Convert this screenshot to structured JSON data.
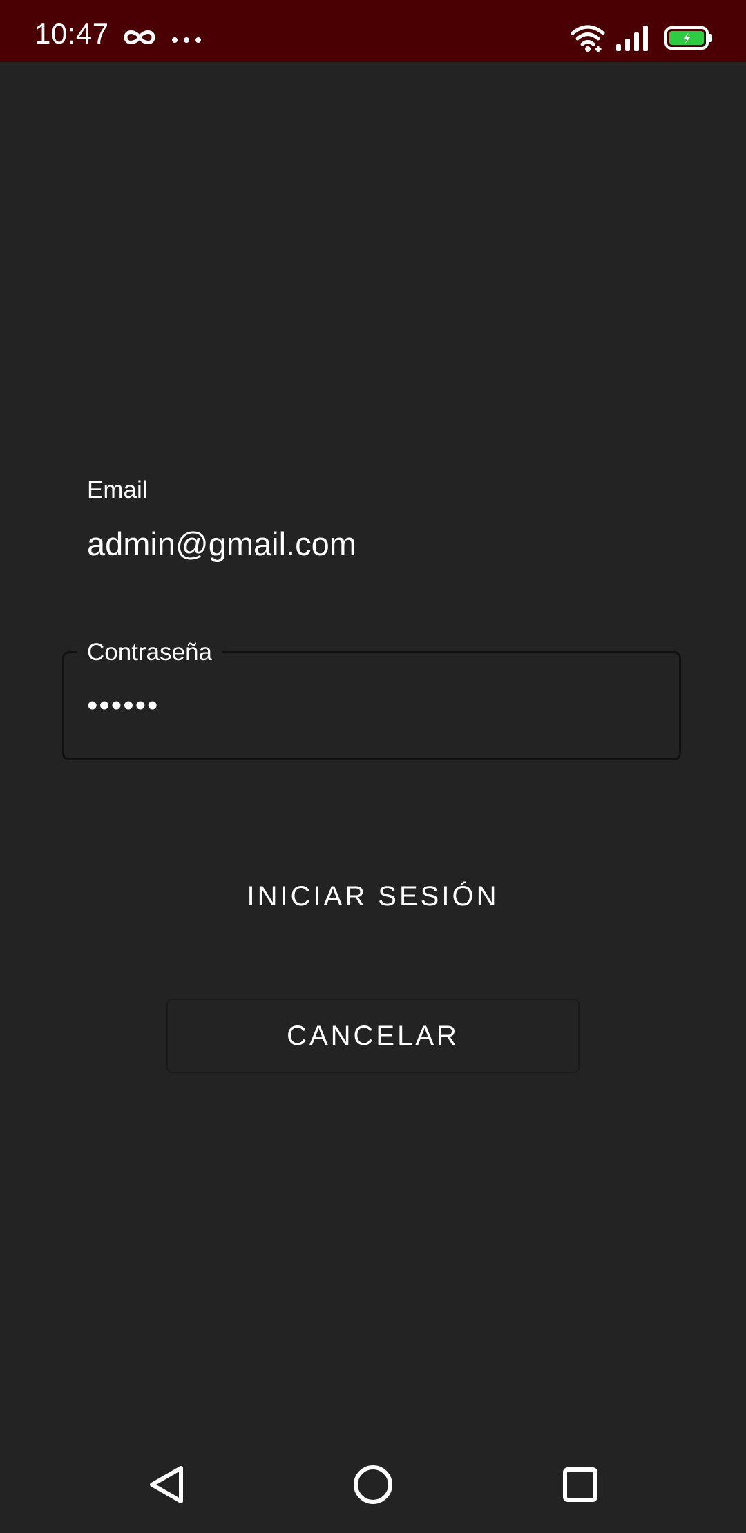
{
  "status_bar": {
    "time": "10:47",
    "icons": [
      "infinity-icon",
      "more-dots-icon",
      "wifi-icon",
      "signal-icon",
      "battery-charging-icon"
    ],
    "background_color": "#4a0003",
    "battery_color": "#2ecc40"
  },
  "form": {
    "email_label": "Email",
    "email_value": "admin@gmail.com",
    "password_label": "Contraseña",
    "password_value": "••••••"
  },
  "actions": {
    "login_label": "INICIAR SESIÓN",
    "cancel_label": "CANCELAR"
  },
  "nav_bar": {
    "icons": [
      "back-triangle-icon",
      "home-circle-icon",
      "recents-square-icon"
    ]
  },
  "colors": {
    "background": "#232323",
    "text": "#ffffff"
  }
}
